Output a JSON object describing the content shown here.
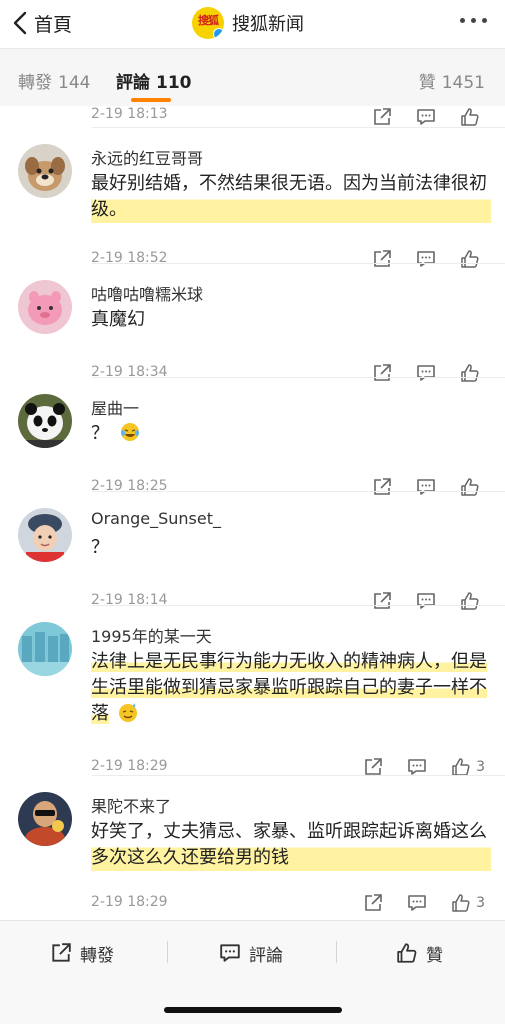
{
  "header": {
    "back_label": "首頁",
    "title": "搜狐新闻",
    "logo_text": "搜狐"
  },
  "tabs": {
    "repost": {
      "label": "轉發",
      "count": "144"
    },
    "comment": {
      "label": "評論",
      "count": "110"
    },
    "like": {
      "label": "贊",
      "count": "1451"
    }
  },
  "comments": [
    {
      "user": "",
      "text": "",
      "time": "2-19 18:13",
      "likes": ""
    },
    {
      "user": "永远的红豆哥哥",
      "text": "最好别结婚，不然结果很无语。因为当前法律很初级。",
      "time": "2-19 18:52",
      "likes": ""
    },
    {
      "user": "咕噜咕噜糯米球",
      "text": "真魔幻",
      "time": "2-19 18:34",
      "likes": ""
    },
    {
      "user": "屋曲一",
      "text": "？",
      "time": "2-19 18:25",
      "likes": ""
    },
    {
      "user": "Orange_Sunset_",
      "text": "？",
      "time": "2-19 18:14",
      "likes": ""
    },
    {
      "user": "1995年的某一天",
      "text": "法律上是无民事行为能力无收入的精神病人，但是生活里能做到猜忌家暴监听跟踪自己的妻子一样不落",
      "time": "2-19 18:29",
      "likes": "3"
    },
    {
      "user": "果陀不来了",
      "text": "好笑了，丈夫猜忌、家暴、监听跟踪起诉离婚这么多次这么久还要给男的钱",
      "time": "2-19 18:29",
      "likes": "3"
    }
  ],
  "bottom": {
    "repost": "轉發",
    "comment": "評論",
    "like": "贊"
  },
  "colors": {
    "accent": "#ff8200",
    "highlight": "#ffef82"
  }
}
